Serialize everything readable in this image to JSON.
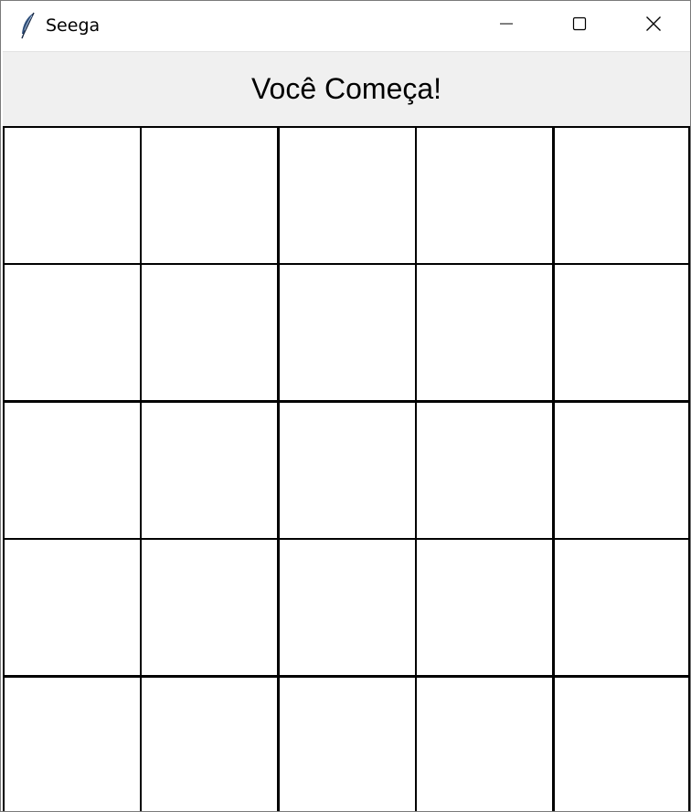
{
  "window": {
    "title": "Seega",
    "app_icon": "feather-icon",
    "controls": [
      "minimize-icon",
      "maximize-icon",
      "close-icon"
    ]
  },
  "status": {
    "message": "Você Começa!"
  },
  "board": {
    "rows": 5,
    "cols": 5,
    "cells": [
      [
        "",
        "",
        "",
        "",
        ""
      ],
      [
        "",
        "",
        "",
        "",
        ""
      ],
      [
        "",
        "",
        "",
        "",
        ""
      ],
      [
        "",
        "",
        "",
        "",
        ""
      ],
      [
        "",
        "",
        "",
        "",
        ""
      ]
    ],
    "line_color": "#000000",
    "cell_color": "#ffffff"
  },
  "colors": {
    "header_background": "#f0f0f0",
    "titlebar_background": "#ffffff"
  }
}
